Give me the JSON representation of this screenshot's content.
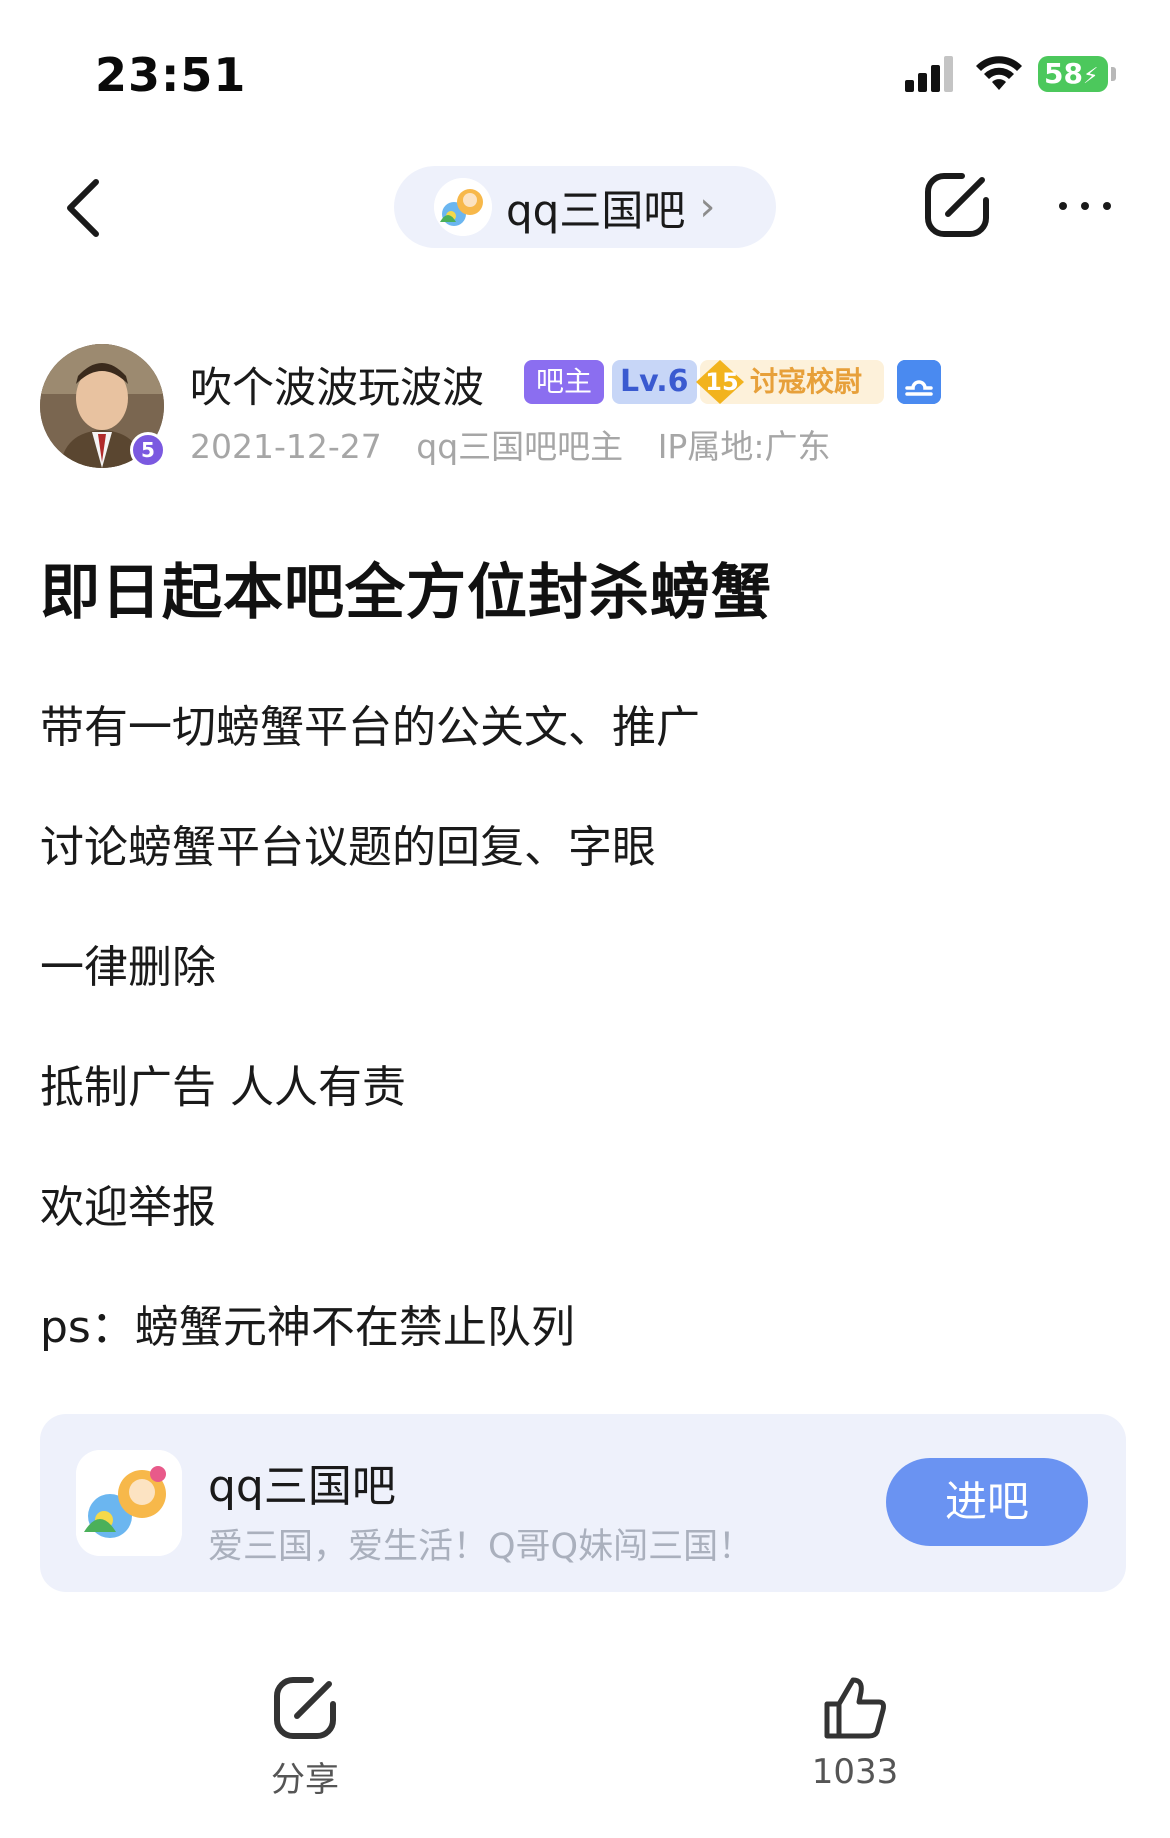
{
  "status_bar": {
    "time": "23:51",
    "battery": "58",
    "icons": [
      "signal-icon",
      "wifi-icon",
      "battery-charging-icon"
    ]
  },
  "nav": {
    "forum_pill_label": "qq三国吧",
    "icons": [
      "back-icon",
      "forum-logo-icon",
      "chevron-right-icon",
      "share-icon",
      "more-icon"
    ]
  },
  "author": {
    "name": "吹个波波玩波波",
    "avatar_badge": "5",
    "tag_owner": "吧主",
    "tag_level": "Lv.6",
    "rank_number": "15",
    "rank_title": "讨寇校尉",
    "zodiac_icon": "libra-icon",
    "date": "2021-12-27",
    "role": "qq三国吧吧主",
    "ip": "IP属地:广东"
  },
  "post": {
    "title": "即日起本吧全方位封杀螃蟹",
    "lines": [
      "带有一切螃蟹平台的公关文、推广",
      "讨论螃蟹平台议题的回复、字眼",
      "一律删除",
      "抵制广告 人人有责",
      "欢迎举报",
      "ps：螃蟹元神不在禁止队列"
    ]
  },
  "forum_card": {
    "name": "qq三国吧",
    "slogan": "爱三国，爱生活！Q哥Q妹闯三国！",
    "enter_label": "进吧"
  },
  "bottom_bar": {
    "share_label": "分享",
    "like_count": "1033",
    "icons": [
      "share-icon",
      "thumbs-up-icon"
    ]
  },
  "colors": {
    "accent_blue": "#6a93f2",
    "pill_bg": "#eef1fb",
    "owner_tag": "#8b6ef0",
    "level_tag_bg": "#c7d6f7",
    "rank_tag_bg": "#fdf1da",
    "rank_gold": "#f2b31d",
    "battery_green": "#4cc85c"
  }
}
